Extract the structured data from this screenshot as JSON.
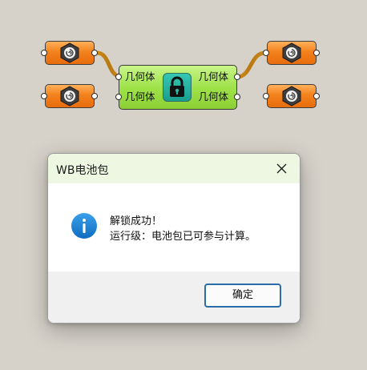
{
  "canvas": {
    "component": {
      "inputs": [
        "几何体",
        "几何体"
      ],
      "outputs": [
        "几何体",
        "几何体"
      ],
      "icon": "lock-icon"
    },
    "params": [
      {
        "icon": "hexagon-nut-icon"
      },
      {
        "icon": "hexagon-nut-icon"
      },
      {
        "icon": "hexagon-nut-icon"
      },
      {
        "icon": "hexagon-nut-icon"
      }
    ],
    "colors": {
      "background": "#d6d2ca",
      "param_fill": "#f3821d",
      "component_fill": "#9fe24a",
      "wire": "#d08a1a"
    }
  },
  "dialog": {
    "title": "WB电池包",
    "close_icon": "close-icon",
    "info_icon": "info-icon",
    "message_line1": "解锁成功！",
    "message_line2": "运行级：电池包已可参与计算。",
    "ok_label": "确定",
    "colors": {
      "titlebar": "#eef7e1",
      "footer": "#f0f0f0",
      "button_border": "#2b6da8",
      "info_icon": "#1b7fd4"
    }
  }
}
